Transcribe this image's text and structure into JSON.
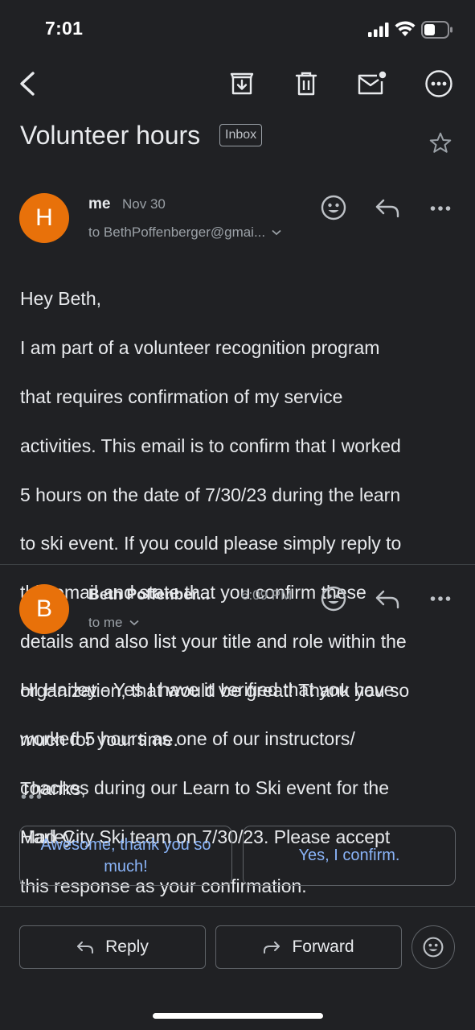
{
  "status_bar": {
    "time": "7:01"
  },
  "subject": {
    "title": "Volunteer hours",
    "label": "Inbox"
  },
  "messages": [
    {
      "avatar_letter": "H",
      "sender": "me",
      "date": "Nov 30",
      "to": "to BethPoffenberger@gmai...",
      "body_lines": [
        "Hey Beth,",
        "I am part of a volunteer recognition program",
        "that requires confirmation of my service",
        "activities. This email is to confirm that I worked",
        "5 hours on the date of 7/30/23 during the learn",
        "to ski event. If you could please simply reply to",
        "this email and state that you confirm these",
        "details and also list your title and role within the",
        "organization, that would be great! Thank you so",
        "much for your time.",
        "Thanks,",
        "Harley"
      ]
    },
    {
      "avatar_letter": "B",
      "sender": "Beth Poffenber...",
      "date": "6:09 PM",
      "to": "to me",
      "body_lines": [
        "HI Harley - Yes I have it verified that you have",
        "worked 5 hours as one of our instructors/",
        "coaches during our Learn to Ski event for the",
        "Mad-City Ski team on 7/30/23.  Please accept",
        "this response as your confirmation."
      ]
    }
  ],
  "smart_replies": [
    {
      "label": "Awesome, thank you so much!"
    },
    {
      "label": "Yes, I confirm."
    }
  ],
  "actions": {
    "reply_label": "Reply",
    "forward_label": "Forward"
  },
  "colors": {
    "background": "#202124",
    "avatar": "#e8710a",
    "accent": "#8ab4f8"
  },
  "icons": [
    "back-icon",
    "archive-icon",
    "trash-icon",
    "mark-unread-icon",
    "more-icon",
    "star-icon",
    "emoji-icon",
    "reply-icon",
    "chevron-down-icon",
    "forward-icon"
  ]
}
